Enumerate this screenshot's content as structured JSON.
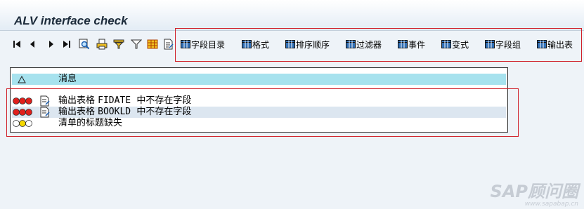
{
  "window": {
    "title": "ALV interface check"
  },
  "toolbar": {
    "nav_icons": [
      "first-page-icon",
      "previous-page-icon",
      "next-page-icon",
      "last-page-icon",
      "find-icon",
      "print-icon",
      "filter-set-icon",
      "filter-icon",
      "layout-grid-icon",
      "export-doc-icon"
    ],
    "buttons": [
      {
        "label": "字段目录",
        "icon": "grid-icon"
      },
      {
        "label": "格式",
        "icon": "grid-icon"
      },
      {
        "label": "排序顺序",
        "icon": "grid-icon"
      },
      {
        "label": "过滤器",
        "icon": "grid-icon"
      },
      {
        "label": "事件",
        "icon": "grid-icon"
      },
      {
        "label": "变式",
        "icon": "grid-icon"
      },
      {
        "label": "字段组",
        "icon": "grid-icon"
      },
      {
        "label": "输出表",
        "icon": "grid-icon"
      }
    ]
  },
  "messages": {
    "header_label": "消息",
    "rows": [
      {
        "status": "error",
        "text_prefix": "输出表格 ",
        "field": "FIDATE",
        "text_suffix": "  中不存在字段"
      },
      {
        "status": "error",
        "text_prefix": "输出表格 ",
        "field": "BOOKLD",
        "text_suffix": "  中不存在字段"
      },
      {
        "status": "warning",
        "text_prefix": "清单的标题缺失",
        "field": "",
        "text_suffix": ""
      }
    ]
  },
  "colors": {
    "accent_highlight": "#a7e2ee",
    "row_selected": "#dce6f0",
    "error_light": "#e0201c",
    "warning_light": "#f5d800",
    "annotation_border": "#d0202a"
  },
  "watermark": {
    "main": "SAP顾问圈",
    "sub": "www.sapabap.cn"
  }
}
